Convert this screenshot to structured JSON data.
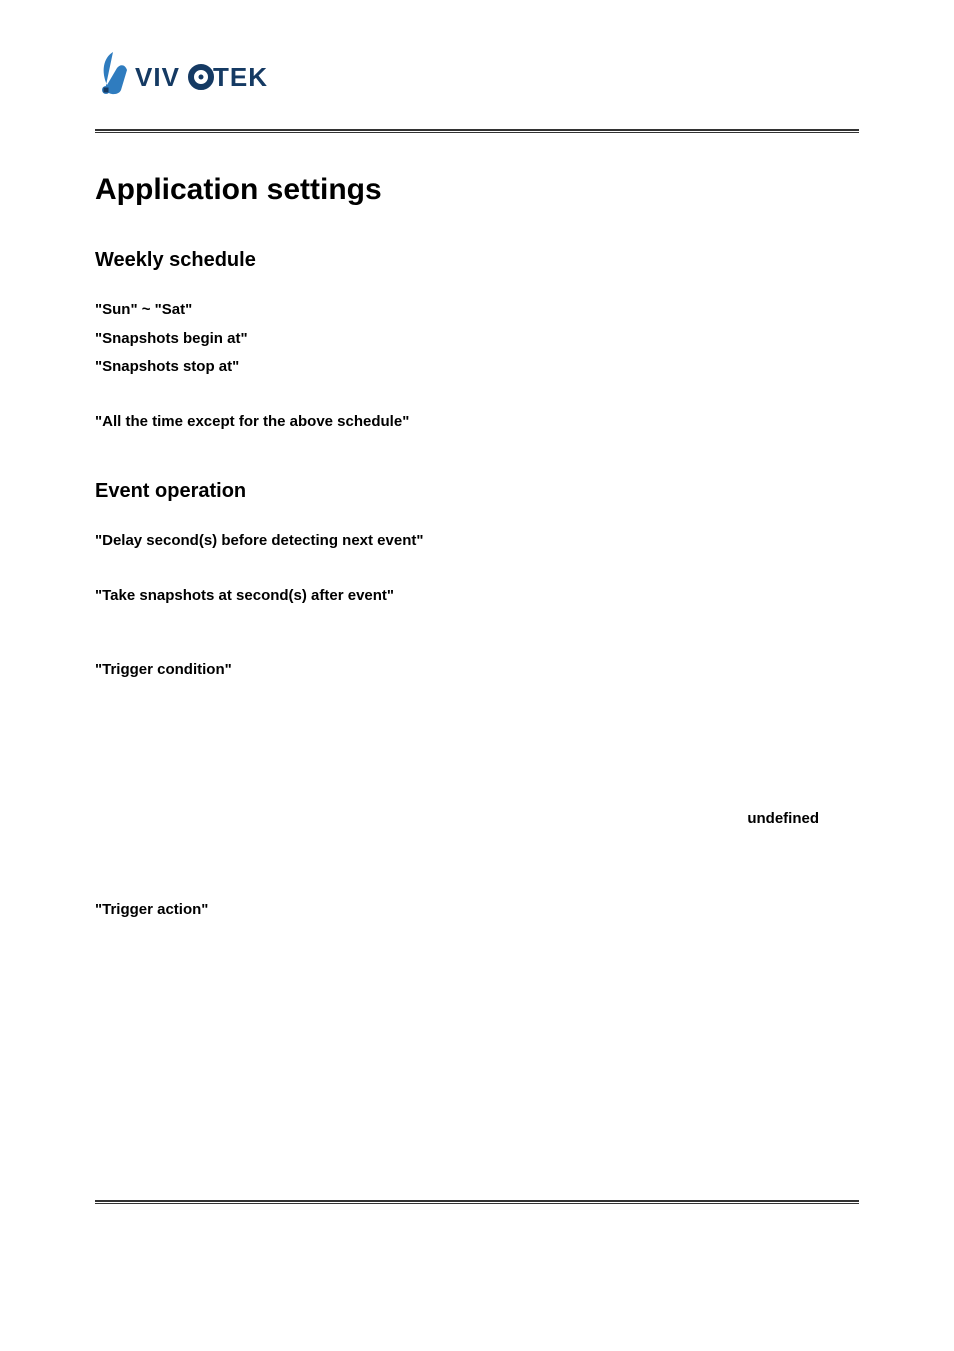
{
  "brand": "VIVOTEK",
  "headings": {
    "title": "Application settings",
    "section1": "Weekly schedule",
    "section2": "Event operation"
  },
  "lines": {
    "sun_sat": "\"Sun\" ~ \"Sat\"",
    "snap_begin": "\"Snapshots begin at\"",
    "snap_stop": "\"Snapshots stop at\"",
    "all_except": "\"All the time except for the above schedule\"",
    "delay": "\"Delay  second(s)  before  detecting  next  event\"",
    "take_after": "\"Take snapshots at second(s) after event\"",
    "trigger_cond": "\"Trigger  condition\"",
    "undefined": "undefined",
    "trigger_action": "\"Trigger  action\""
  }
}
